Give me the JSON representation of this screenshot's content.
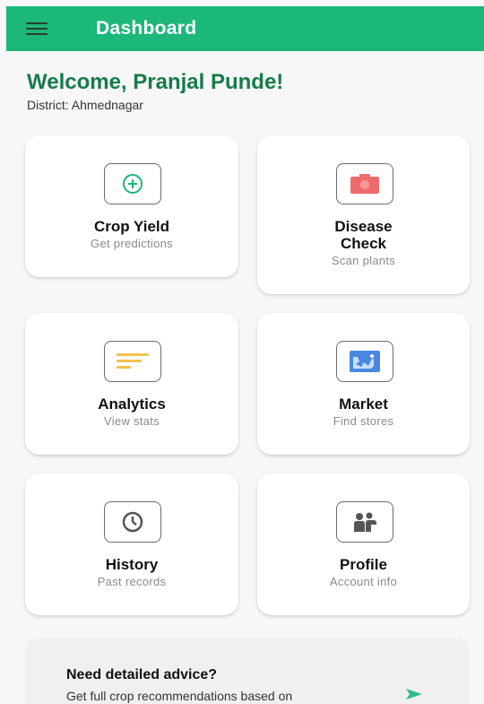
{
  "appbar": {
    "title": "Dashboard",
    "color": "#1cb77a"
  },
  "welcome": {
    "greeting": "Welcome, Pranjal Punde!",
    "district": "District: Ahmednagar"
  },
  "cards": [
    {
      "title": "Crop Yield",
      "subtitle": "Get predictions",
      "icon": "plus-circle-icon",
      "icon_color": "#1cb77a"
    },
    {
      "title": "Disease\nCheck",
      "title_line1": "Disease",
      "title_line2": "Check",
      "subtitle": "Scan plants",
      "icon": "camera-icon",
      "icon_color": "#ef6b6b"
    },
    {
      "title": "Analytics",
      "subtitle": "View stats",
      "icon": "bar-lines-icon",
      "icon_color": "#f2c14e"
    },
    {
      "title": "Market",
      "subtitle": "Find stores",
      "icon": "map-image-icon",
      "icon_color": "#3f7fd9"
    },
    {
      "title": "History",
      "subtitle": "Past records",
      "icon": "clock-icon",
      "icon_color": "#555555"
    },
    {
      "title": "Profile",
      "subtitle": "Account info",
      "icon": "people-icon",
      "icon_color": "#555555"
    }
  ],
  "advice": {
    "title": "Need detailed advice?",
    "text": "Get full crop recommendations based on",
    "arrow_color": "#2bbf84"
  }
}
